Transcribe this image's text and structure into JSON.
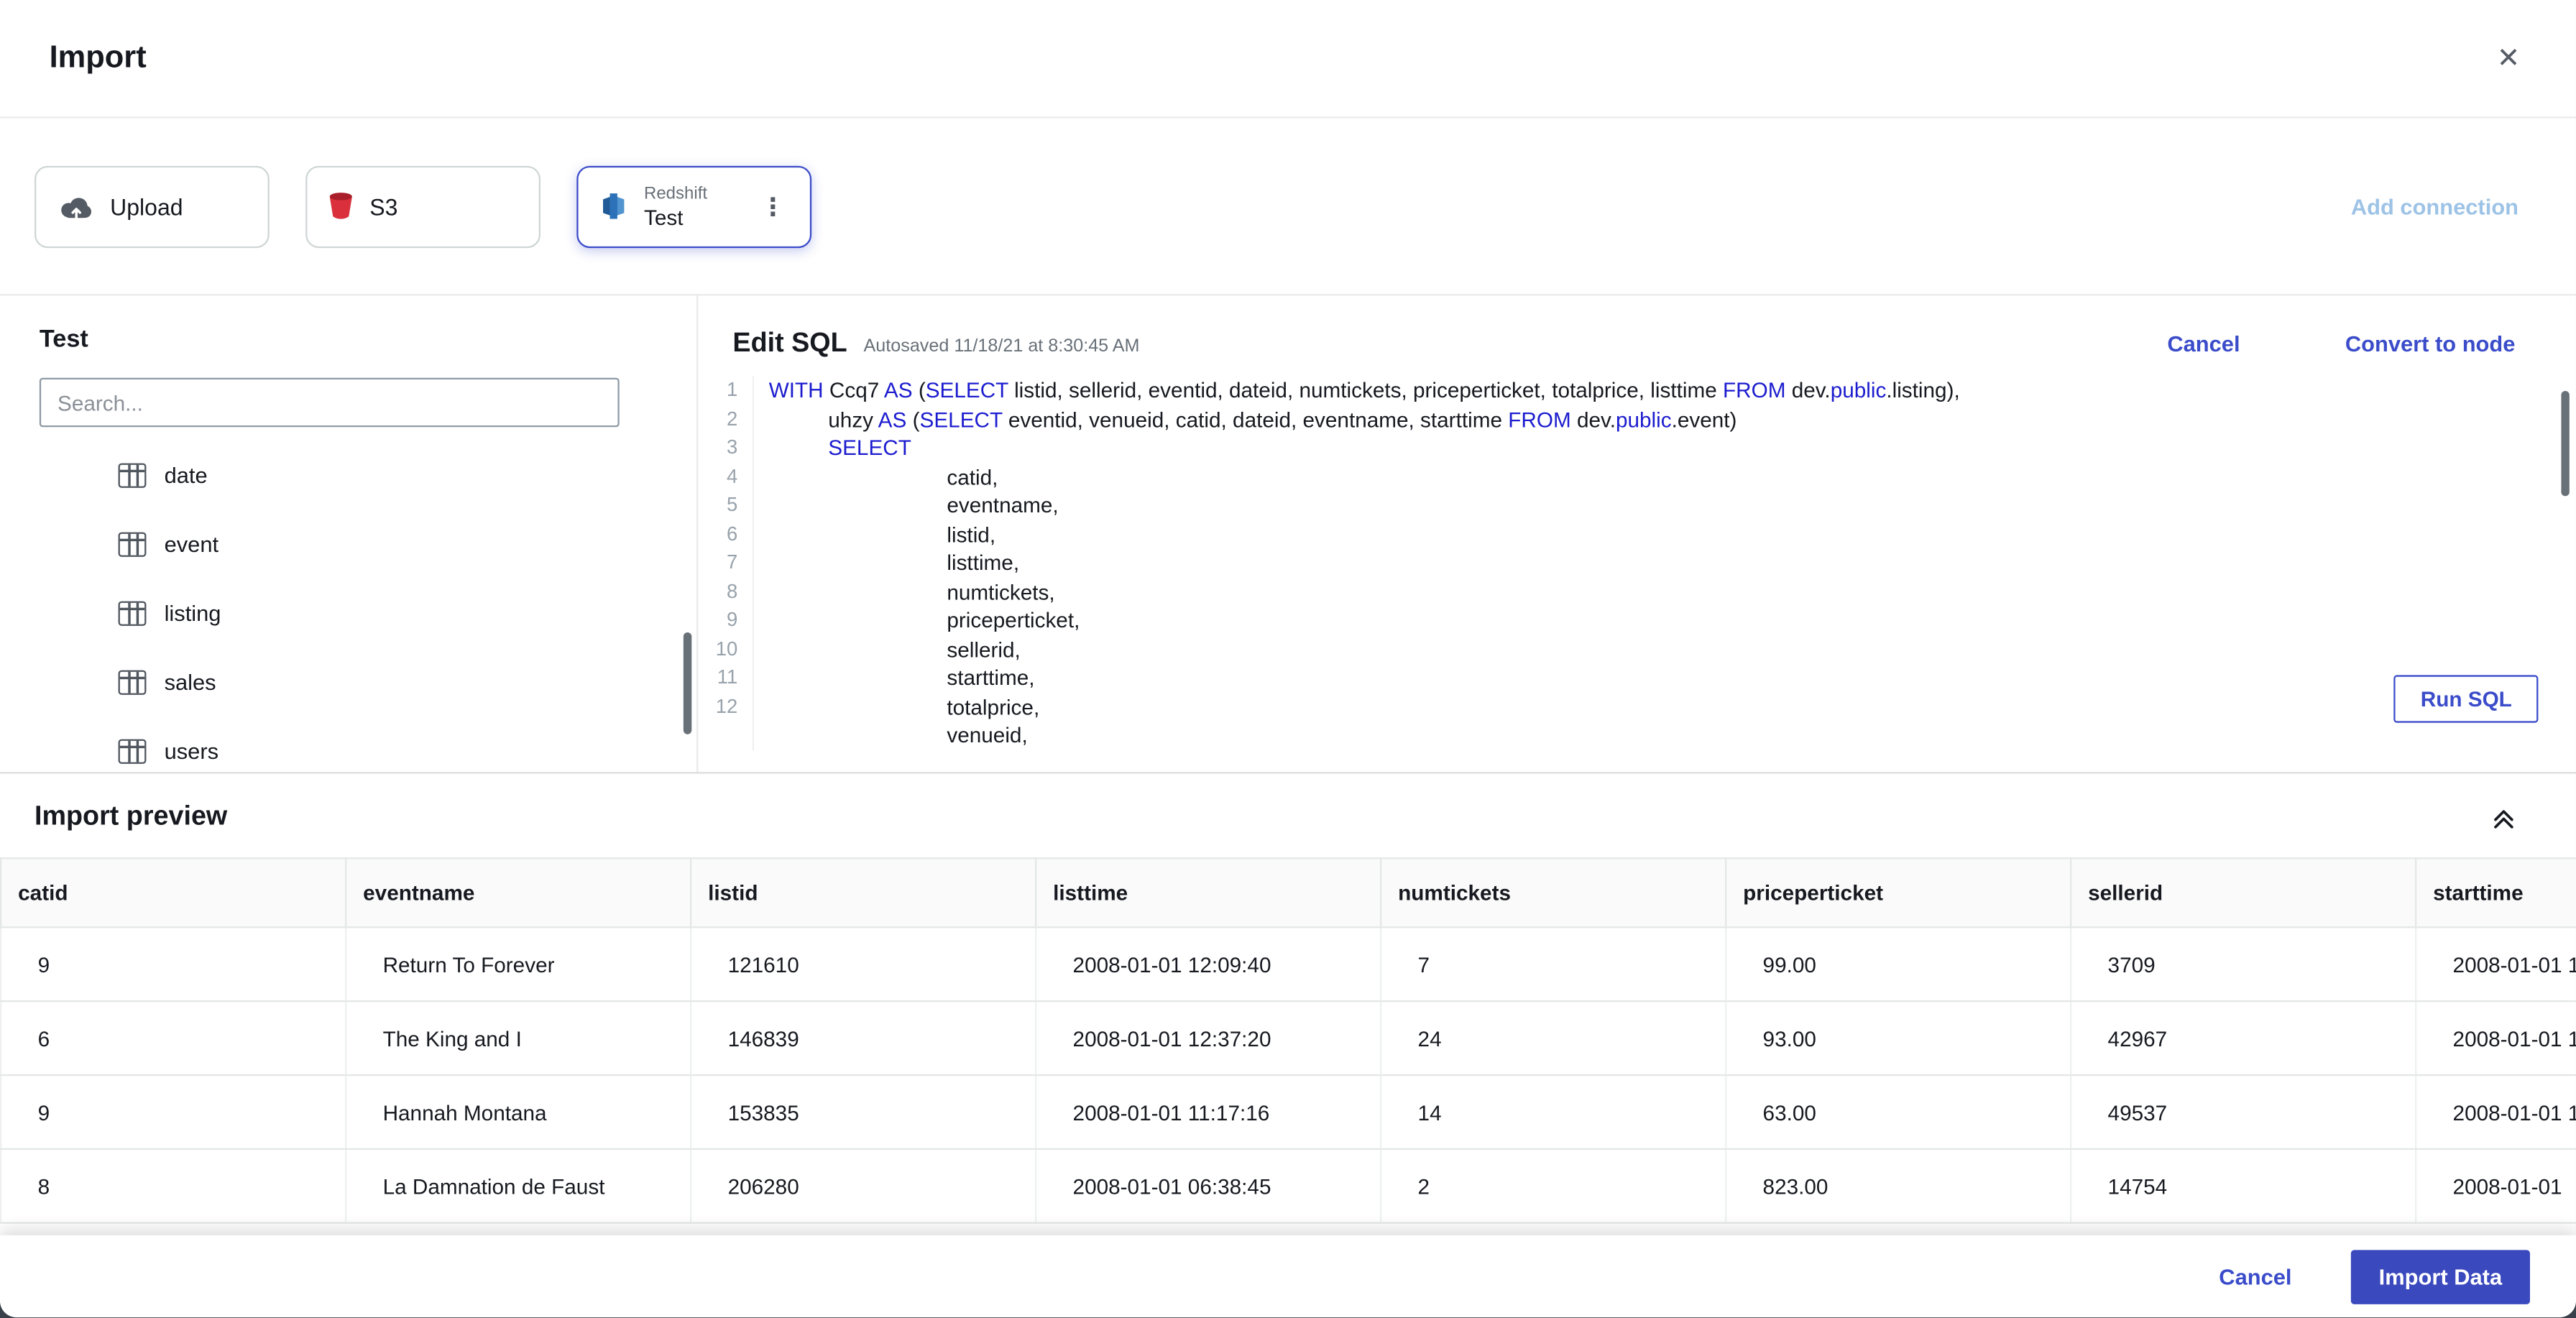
{
  "colors": {
    "accent": "#3b4cca",
    "import_button_bg": "#3b49be",
    "sql_keyword": "#1c1ccf",
    "add_connection_link": "#9dc3e6"
  },
  "icons": {
    "close": "✕",
    "kebab": "⋮"
  },
  "header": {
    "title": "Import"
  },
  "connections": {
    "upload_label": "Upload",
    "s3_label": "S3",
    "redshift_type": "Redshift",
    "redshift_name": "Test",
    "add_connection_label": "Add connection"
  },
  "sidebar": {
    "title": "Test",
    "search_placeholder": "Search...",
    "tables": [
      "date",
      "event",
      "listing",
      "sales",
      "users"
    ]
  },
  "editor": {
    "title": "Edit SQL",
    "autosave_text": "Autosaved 11/18/21 at 8:30:45 AM",
    "cancel_label": "Cancel",
    "convert_label": "Convert to node",
    "run_sql_label": "Run SQL",
    "line_numbers": [
      "1",
      "2",
      "3",
      "4",
      "5",
      "6",
      "7",
      "8",
      "9",
      "10",
      "11",
      "12"
    ],
    "sql_lines": [
      [
        {
          "t": "WITH ",
          "k": true
        },
        {
          "t": "Ccq7 "
        },
        {
          "t": "AS ",
          "k": true
        },
        {
          "t": "("
        },
        {
          "t": "SELECT ",
          "k": true
        },
        {
          "t": "listid, sellerid, eventid, dateid, numtickets, priceperticket, totalprice, listtime "
        },
        {
          "t": "FROM ",
          "k": true
        },
        {
          "t": "dev."
        },
        {
          "t": "public",
          "k": true
        },
        {
          "t": ".listing),"
        }
      ],
      [
        {
          "t": "          uhzy "
        },
        {
          "t": "AS ",
          "k": true
        },
        {
          "t": "("
        },
        {
          "t": "SELECT ",
          "k": true
        },
        {
          "t": "eventid, venueid, catid, dateid, eventname, starttime "
        },
        {
          "t": "FROM ",
          "k": true
        },
        {
          "t": "dev."
        },
        {
          "t": "public",
          "k": true
        },
        {
          "t": ".event)"
        }
      ],
      [
        {
          "t": "          "
        },
        {
          "t": "SELECT",
          "k": true
        }
      ],
      [
        {
          "t": "                              catid,"
        }
      ],
      [
        {
          "t": "                              eventname,"
        }
      ],
      [
        {
          "t": "                              listid,"
        }
      ],
      [
        {
          "t": "                              listtime,"
        }
      ],
      [
        {
          "t": "                              numtickets,"
        }
      ],
      [
        {
          "t": "                              priceperticket,"
        }
      ],
      [
        {
          "t": "                              sellerid,"
        }
      ],
      [
        {
          "t": "                              starttime,"
        }
      ],
      [
        {
          "t": "                              totalprice,"
        }
      ],
      [
        {
          "t": "                              venueid,"
        }
      ]
    ]
  },
  "preview": {
    "title": "Import preview",
    "columns": [
      "catid",
      "eventname",
      "listid",
      "listtime",
      "numtickets",
      "priceperticket",
      "sellerid",
      "starttime"
    ],
    "rows": [
      [
        "9",
        "Return To Forever",
        "121610",
        "2008-01-01 12:09:40",
        "7",
        "99.00",
        "3709",
        "2008-01-01 1"
      ],
      [
        "6",
        "The King and I",
        "146839",
        "2008-01-01 12:37:20",
        "24",
        "93.00",
        "42967",
        "2008-01-01 1"
      ],
      [
        "9",
        "Hannah Montana",
        "153835",
        "2008-01-01 11:17:16",
        "14",
        "63.00",
        "49537",
        "2008-01-01 1"
      ],
      [
        "8",
        "La Damnation de Faust",
        "206280",
        "2008-01-01 06:38:45",
        "2",
        "823.00",
        "14754",
        "2008-01-01"
      ]
    ]
  },
  "footer": {
    "cancel_label": "Cancel",
    "import_label": "Import Data"
  }
}
